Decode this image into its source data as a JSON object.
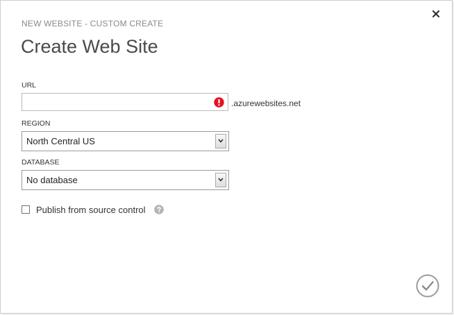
{
  "dialog": {
    "subtitle": "NEW WEBSITE - CUSTOM CREATE",
    "title": "Create Web Site"
  },
  "url": {
    "label": "URL",
    "value": "",
    "placeholder": "",
    "suffix": ".azurewebsites.net",
    "error_icon": "error-exclamation-icon"
  },
  "region": {
    "label": "REGION",
    "selected": "North Central US"
  },
  "database": {
    "label": "DATABASE",
    "selected": "No database"
  },
  "publish": {
    "label": "Publish from source control",
    "checked": false,
    "help_icon": "help-question-icon"
  },
  "icons": {
    "close": "close-icon",
    "confirm": "checkmark-circle-icon",
    "dropdown": "chevron-down-icon"
  },
  "colors": {
    "error_red": "#e81123",
    "muted_gray": "#8a8a8a",
    "title_gray": "#4a4a4a",
    "help_gray": "#b5b5b5"
  }
}
